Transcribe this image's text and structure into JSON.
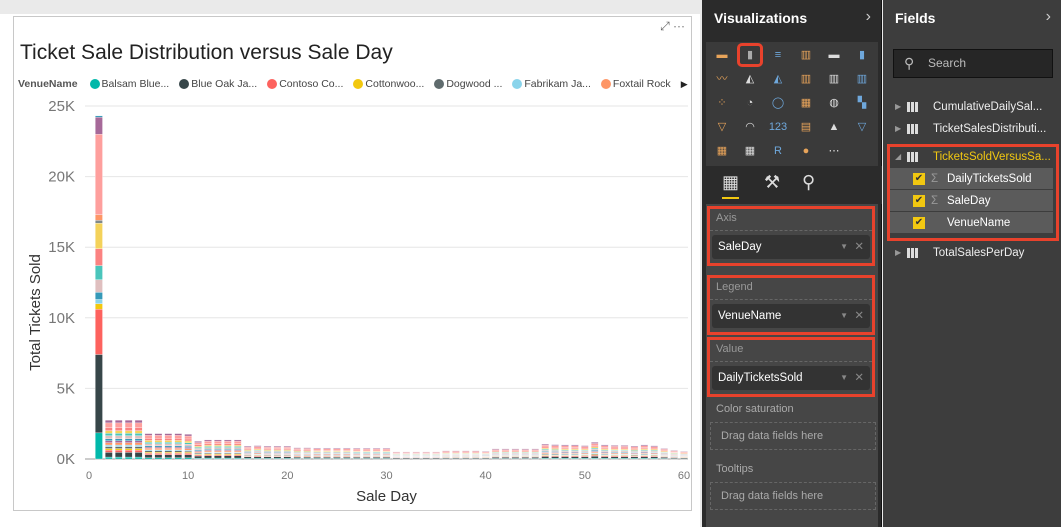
{
  "visual": {
    "title": "Ticket Sale Distribution versus Sale Day",
    "legend_title": "VenueName",
    "legend": [
      {
        "name": "Balsam Blue...",
        "color": "#01b8aa"
      },
      {
        "name": "Blue Oak Ja...",
        "color": "#374649"
      },
      {
        "name": "Contoso Co...",
        "color": "#fd625e"
      },
      {
        "name": "Cottonwoo...",
        "color": "#f2c80f"
      },
      {
        "name": "Dogwood ...",
        "color": "#5f6b6d"
      },
      {
        "name": "Fabrikam Ja...",
        "color": "#8ad4eb"
      },
      {
        "name": "Foxtail Rock",
        "color": "#fe9666"
      }
    ]
  },
  "chart_data": {
    "type": "bar",
    "stacked": true,
    "title": "Ticket Sale Distribution versus Sale Day",
    "xlabel": "Sale Day",
    "ylabel": "Total Tickets Sold",
    "xlim": [
      0,
      60
    ],
    "ylim": [
      0,
      25000
    ],
    "xticks": [
      "0",
      "10",
      "20",
      "30",
      "40",
      "50",
      "60"
    ],
    "yticks": [
      "0K",
      "5K",
      "10K",
      "15K",
      "20K",
      "25K"
    ],
    "grid": true,
    "legend_position": "top",
    "x": [
      1,
      2,
      3,
      4,
      5,
      6,
      7,
      8,
      9,
      10,
      11,
      12,
      13,
      14,
      15,
      16,
      17,
      18,
      19,
      20,
      21,
      22,
      23,
      24,
      25,
      26,
      27,
      28,
      29,
      30,
      31,
      32,
      33,
      34,
      35,
      36,
      37,
      38,
      39,
      40,
      41,
      42,
      43,
      44,
      45,
      46,
      47,
      48,
      49,
      50,
      51,
      52,
      53,
      54,
      55,
      56,
      57,
      58,
      59,
      60
    ],
    "values": [
      24300,
      2750,
      2750,
      2750,
      2750,
      1800,
      1800,
      1800,
      1800,
      1750,
      1250,
      1350,
      1350,
      1350,
      1350,
      900,
      950,
      900,
      900,
      900,
      800,
      800,
      780,
      780,
      780,
      780,
      760,
      760,
      760,
      760,
      500,
      500,
      500,
      500,
      500,
      580,
      580,
      580,
      580,
      560,
      720,
      720,
      720,
      720,
      720,
      1050,
      1020,
      1000,
      1000,
      950,
      1180,
      1000,
      960,
      960,
      920,
      1000,
      940,
      740,
      600,
      540
    ],
    "day1_segments": [
      {
        "color": "#01b8aa",
        "value": 1850
      },
      {
        "color": "#374649",
        "value": 5550
      },
      {
        "color": "#fd625e",
        "value": 3200
      },
      {
        "color": "#f2c80f",
        "value": 400
      },
      {
        "color": "#8ad4eb",
        "value": 300
      },
      {
        "color": "#3599b8",
        "value": 500
      },
      {
        "color": "#dfbfbf",
        "value": 900
      },
      {
        "color": "#4ac5bb",
        "value": 1000
      },
      {
        "color": "#fb8281",
        "value": 1200
      },
      {
        "color": "#f4d25a",
        "value": 1800
      },
      {
        "color": "#7f898a",
        "value": 200
      },
      {
        "color": "#fe9666",
        "value": 400
      },
      {
        "color": "#fe9f9d",
        "value": 5700
      },
      {
        "color": "#a66999",
        "value": 1200
      },
      {
        "color": "#3599b8",
        "value": 100
      }
    ]
  },
  "viz": {
    "title": "Visualizations",
    "wells": {
      "axis_label": "Axis",
      "axis_value": "SaleDay",
      "legend_label": "Legend",
      "legend_value": "VenueName",
      "value_label": "Value",
      "value_value": "DailyTicketsSold",
      "color_sat_label": "Color saturation",
      "tooltips_label": "Tooltips",
      "drop_hint": "Drag data fields here"
    }
  },
  "fields": {
    "title": "Fields",
    "search_placeholder": "Search",
    "tables": [
      "CumulativeDailySal...",
      "TicketSalesDistributi...",
      "TicketsSoldVersusSa...",
      "TotalSalesPerDay"
    ],
    "columns": [
      "DailyTicketsSold",
      "SaleDay",
      "VenueName"
    ]
  }
}
